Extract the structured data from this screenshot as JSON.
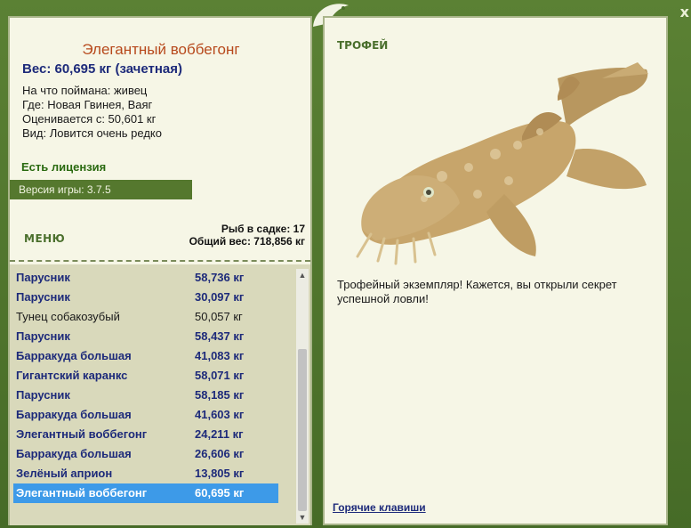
{
  "window": {
    "close_label": "x"
  },
  "fish": {
    "title": "Элегантный воббегонг",
    "weight": "Вес: 60,695 кг (зачетная)",
    "bait": "На что поймана: живец",
    "location": "Где: Новая Гвинея, Ваяг",
    "valued": "Оценивается с: 50,601 кг",
    "species": "Вид: Ловится очень редко"
  },
  "license": "Есть лицензия",
  "version": "Версия игры: 3.7.5",
  "menu_label": "МЕНЮ",
  "keepnet": {
    "count": "Рыб в садке: 17",
    "total": "Общий вес: 718,856 кг"
  },
  "catch_list": [
    {
      "name": "Парусник",
      "weight": "58,736 кг",
      "style": "bold"
    },
    {
      "name": "Парусник",
      "weight": "30,097 кг",
      "style": "bold"
    },
    {
      "name": "Тунец собакозубый",
      "weight": "50,057 кг",
      "style": "normal"
    },
    {
      "name": "Парусник",
      "weight": "58,437 кг",
      "style": "bold"
    },
    {
      "name": "Барракуда большая",
      "weight": "41,083 кг",
      "style": "bold"
    },
    {
      "name": "Гигантский каранкс",
      "weight": "58,071 кг",
      "style": "bold"
    },
    {
      "name": "Парусник",
      "weight": "58,185 кг",
      "style": "bold"
    },
    {
      "name": "Барракуда большая",
      "weight": "41,603 кг",
      "style": "bold"
    },
    {
      "name": "Элегантный воббегонг",
      "weight": "24,211 кг",
      "style": "bold"
    },
    {
      "name": "Барракуда большая",
      "weight": "26,606 кг",
      "style": "bold"
    },
    {
      "name": "Зелёный априон",
      "weight": "13,805 кг",
      "style": "bold"
    },
    {
      "name": "Элегантный воббегонг",
      "weight": "60,695 кг",
      "style": "selected"
    }
  ],
  "trophy": {
    "label": "ТРОФЕЙ",
    "text": "Трофейный экземпляр! Кажется, вы открыли секрет успешной ловли!",
    "hotkeys": "Горячие клавиши"
  },
  "colors": {
    "frame_green": "#4a6f2c",
    "panel_bg": "#f6f6e6",
    "list_bg": "#d9d9bb",
    "selection": "#3d9ae8",
    "title_orange": "#b7491c",
    "bold_blue": "#1d2a7a"
  },
  "icons": {
    "logo": "fish-logo-icon",
    "scroll_up": "scroll-up-arrow-icon",
    "scroll_down": "scroll-down-arrow-icon"
  }
}
